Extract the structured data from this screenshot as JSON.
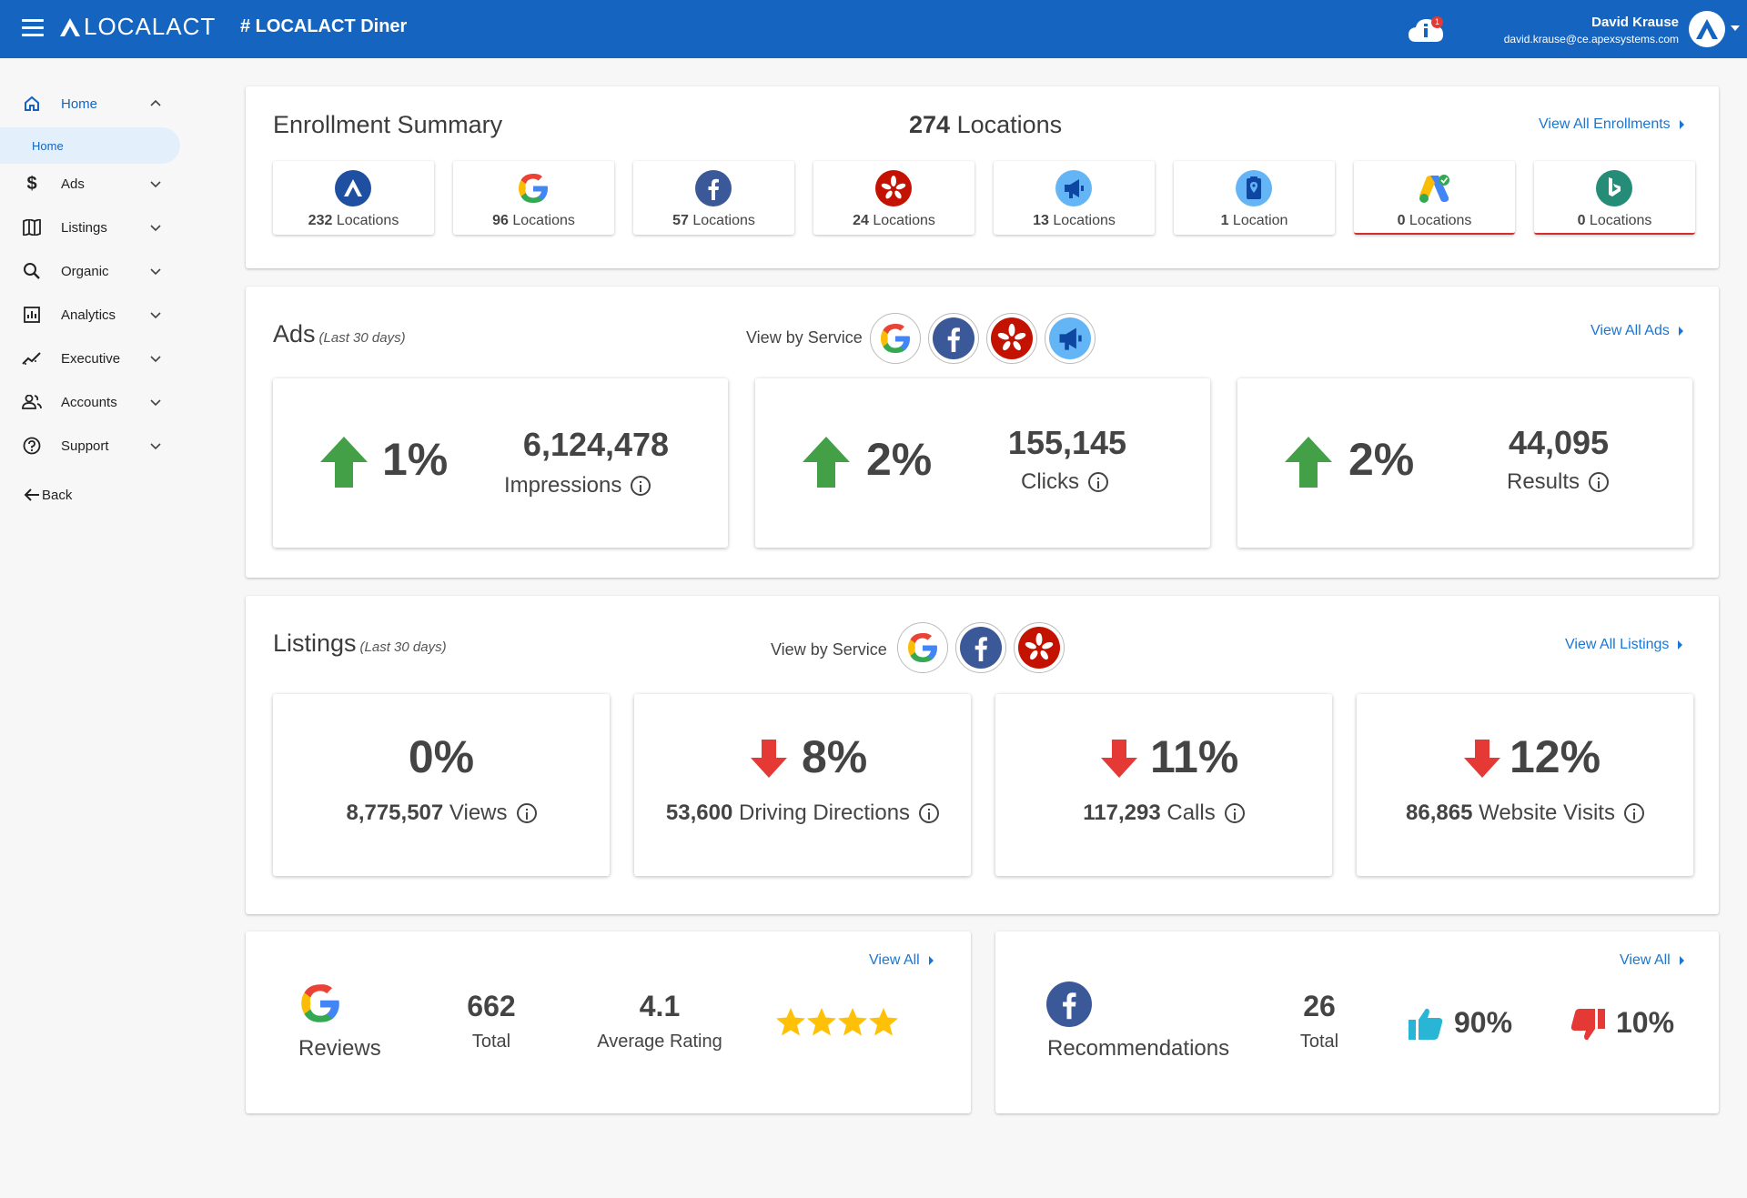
{
  "header": {
    "logo_text": "LOCALACT",
    "title": "# LOCALACT Diner",
    "notification_count": "1",
    "user_name": "David Krause",
    "user_email": "david.krause@ce.apexsystems.com"
  },
  "sidebar": {
    "items": [
      {
        "label": "Home",
        "icon": "home-icon"
      },
      {
        "label": "Ads",
        "icon": "dollar-icon"
      },
      {
        "label": "Listings",
        "icon": "map-icon"
      },
      {
        "label": "Organic",
        "icon": "search-icon"
      },
      {
        "label": "Analytics",
        "icon": "analytics-icon"
      },
      {
        "label": "Executive",
        "icon": "trend-icon"
      },
      {
        "label": "Accounts",
        "icon": "people-icon"
      },
      {
        "label": "Support",
        "icon": "help-icon"
      }
    ],
    "sub_item": "Home",
    "back_label": "Back"
  },
  "enrollment": {
    "title": "Enrollment Summary",
    "total_count": "274",
    "total_label": "Locations",
    "view_all": "View All Enrollments",
    "services": [
      {
        "count": "232",
        "label": "Locations",
        "icon": "localact-icon"
      },
      {
        "count": "96",
        "label": "Locations",
        "icon": "google-icon"
      },
      {
        "count": "57",
        "label": "Locations",
        "icon": "facebook-icon"
      },
      {
        "count": "24",
        "label": "Locations",
        "icon": "yelp-icon"
      },
      {
        "count": "13",
        "label": "Locations",
        "icon": "megaphone-icon"
      },
      {
        "count": "1",
        "label": "Location",
        "icon": "clipboard-location-icon"
      },
      {
        "count": "0",
        "label": "Locations",
        "icon": "google-ads-icon"
      },
      {
        "count": "0",
        "label": "Locations",
        "icon": "bing-icon"
      }
    ]
  },
  "ads": {
    "title": "Ads",
    "period": "(Last 30 days)",
    "view_by": "View by Service",
    "view_all": "View All Ads",
    "stats": [
      {
        "pct": "1%",
        "trend": "up",
        "value": "6,124,478",
        "label": "Impressions"
      },
      {
        "pct": "2%",
        "trend": "up",
        "value": "155,145",
        "label": "Clicks"
      },
      {
        "pct": "2%",
        "trend": "up",
        "value": "44,095",
        "label": "Results"
      }
    ]
  },
  "listings": {
    "title": "Listings",
    "period": "(Last 30 days)",
    "view_by": "View by Service",
    "view_all": "View All Listings",
    "stats": [
      {
        "pct": "0%",
        "trend": "none",
        "value": "8,775,507",
        "label": "Views"
      },
      {
        "pct": "8%",
        "trend": "down",
        "value": "53,600",
        "label": "Driving Directions"
      },
      {
        "pct": "11%",
        "trend": "down",
        "value": "117,293",
        "label": "Calls"
      },
      {
        "pct": "12%",
        "trend": "down",
        "value": "86,865",
        "label": "Website Visits"
      }
    ]
  },
  "reviews": {
    "label": "Reviews",
    "view_all": "View All",
    "total": "662",
    "total_label": "Total",
    "avg": "4.1",
    "avg_label": "Average Rating",
    "stars": 4
  },
  "recommendations": {
    "label": "Recommendations",
    "view_all": "View All",
    "total": "26",
    "total_label": "Total",
    "positive": "90%",
    "negative": "10%"
  },
  "colors": {
    "primary": "#1565c0",
    "up": "#43a047",
    "down": "#e53935",
    "star": "#ffc107",
    "thumb_up": "#29b6d6",
    "thumb_down": "#e53935"
  }
}
